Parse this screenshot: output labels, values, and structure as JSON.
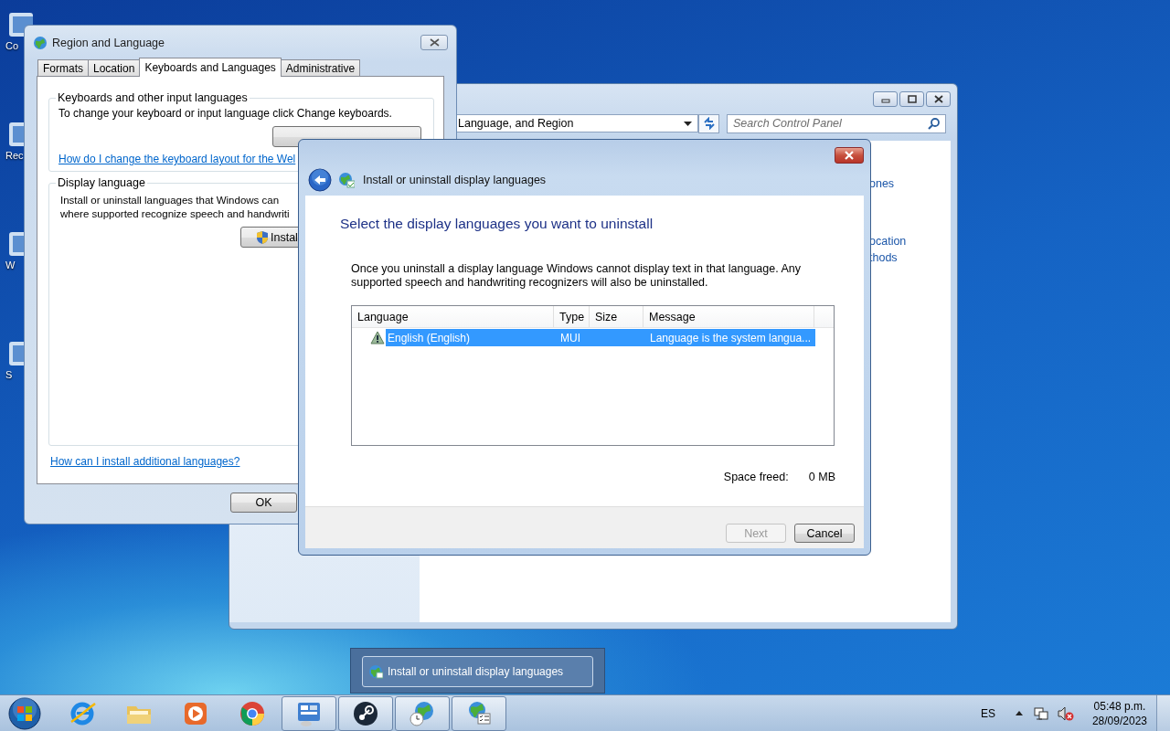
{
  "desktop": {
    "icons": [
      {
        "label": "Co"
      },
      {
        "label": "Rec"
      },
      {
        "label": "W"
      },
      {
        "label": "S"
      }
    ]
  },
  "control_panel": {
    "address": "Language, and Region",
    "search": {
      "placeholder": "Search Control Panel"
    },
    "links": [
      "ones",
      "ocation",
      "thods"
    ]
  },
  "region_dialog": {
    "title": "Region and Language",
    "tabs": [
      {
        "label": "Formats",
        "selected": false
      },
      {
        "label": "Location",
        "selected": false
      },
      {
        "label": "Keyboards and Languages",
        "selected": true
      },
      {
        "label": "Administrative",
        "selected": false
      }
    ],
    "keyboards_group": {
      "title": "Keyboards and other input languages",
      "text": "To change your keyboard or input language click Change keyboards.",
      "link": "How do I change the keyboard layout for the Wel"
    },
    "display_group": {
      "title": "Display language",
      "text": "Install or uninstall languages that Windows can\nwhere supported recognize speech and handwriti",
      "button": "Instal"
    },
    "link": "How can I install additional languages?",
    "ok_button": "OK"
  },
  "install_dialog": {
    "title": "Install or uninstall display languages",
    "heading": "Select the display languages you want to uninstall",
    "description": "Once you uninstall a display language Windows cannot display text in that language. Any supported speech and handwriting recognizers will also be uninstalled.",
    "list": {
      "columns": [
        "Language",
        "Type",
        "Size",
        "Message"
      ],
      "rows": [
        {
          "language": "English (English)",
          "type": "MUI",
          "message": "Language is the system langua...",
          "warning": true,
          "selected": true
        }
      ]
    },
    "space_freed": {
      "label": "Space freed:",
      "value": "0 MB"
    },
    "buttons": [
      {
        "label": "Next",
        "disabled": true
      },
      {
        "label": "Cancel",
        "disabled": false
      }
    ]
  },
  "taskbar": {
    "items": [
      {
        "kind": "ie",
        "open": false
      },
      {
        "kind": "folder",
        "open": false
      },
      {
        "kind": "media",
        "open": false
      },
      {
        "kind": "chrome",
        "open": false
      },
      {
        "kind": "control",
        "open": true
      },
      {
        "kind": "steam",
        "open": true
      },
      {
        "kind": "globe-clock",
        "open": true
      },
      {
        "kind": "globe-list",
        "open": true
      }
    ],
    "thumbnail": {
      "title": "Install or uninstall display languages"
    },
    "tray": {
      "language": "ES",
      "time": "05:48 p.m.",
      "date": "28/09/2023"
    }
  }
}
